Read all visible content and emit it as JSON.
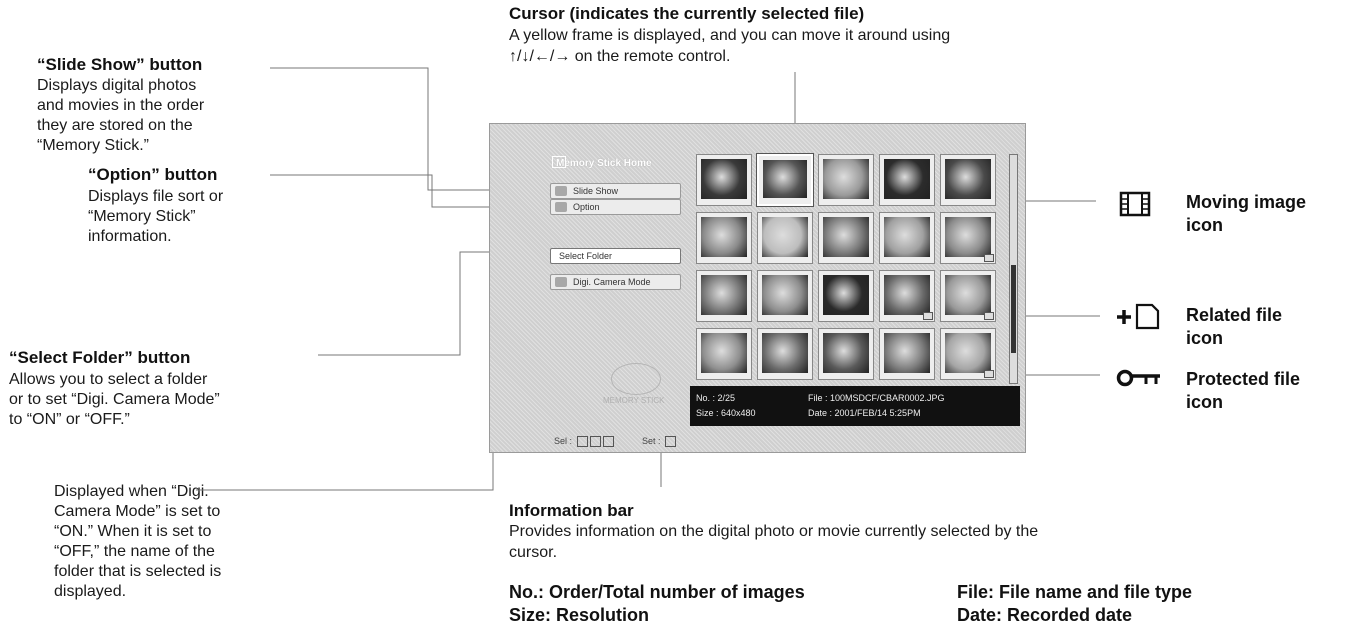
{
  "annotations": {
    "cursor": {
      "title": "Cursor (indicates the currently selected file)",
      "line1": "A yellow frame is displayed, and you can move it around using",
      "line2": "↑/↓/←/→ on the remote control."
    },
    "slide_show": {
      "title": "“Slide Show” button",
      "lines": [
        "Displays digital photos",
        "and movies in the order",
        "they are stored on the",
        "“Memory Stick.”"
      ]
    },
    "option": {
      "title": "“Option” button",
      "lines": [
        "Displays file sort or",
        "“Memory Stick”",
        "information."
      ]
    },
    "select_folder": {
      "title": "“Select Folder” button",
      "lines": [
        "Allows you to select a folder",
        "or to set “Digi. Camera Mode”",
        "to “ON” or “OFF.”"
      ]
    },
    "digi_mode": {
      "lines": [
        "Displayed when “Digi.",
        "Camera Mode” is set to",
        "“ON.” When it is set to",
        "“OFF,” the name of the",
        "folder that is selected is",
        "displayed."
      ]
    },
    "info_bar": {
      "title": "Information bar",
      "line1": "Provides information on the digital photo or movie currently selected by the",
      "line2": "cursor.",
      "no": "No.: Order/Total number of images",
      "size": "Size: Resolution",
      "file": "File: File name and file type",
      "date": "Date: Recorded date"
    },
    "moving_image": {
      "lines": [
        "Moving image",
        "icon"
      ],
      "icon": "film-icon"
    },
    "related_file": {
      "lines": [
        "Related file",
        "icon"
      ],
      "icon": "plus-document-icon"
    },
    "protected_file": {
      "lines": [
        "Protected file",
        "icon"
      ],
      "icon": "key-icon"
    }
  },
  "screen": {
    "title": "Memory Stick Home",
    "buttons": {
      "slide_show": "Slide Show",
      "option": "Option",
      "select_folder": "Select Folder",
      "digi_camera_mode": "Digi. Camera Mode"
    },
    "info": {
      "no": "No. : 2/25",
      "size": "Size : 640x480",
      "file": "File : 100MSDCF/CBAR0002.JPG",
      "date": "Date : 2001/FEB/14 5:25PM"
    },
    "footer": {
      "sel": "Sel :",
      "set": "Set :"
    },
    "thumbnails": [
      {
        "shade": "#3a3a3a"
      },
      {
        "shade": "#555"
      },
      {
        "shade": "#9a9a9a"
      },
      {
        "shade": "#2c2c2c"
      },
      {
        "shade": "#4a4a4a"
      },
      {
        "shade": "#8a8a8a"
      },
      {
        "shade": "#bdbdbd"
      },
      {
        "shade": "#7a7a7a"
      },
      {
        "shade": "#a0a0a0"
      },
      {
        "shade": "#8c8c8c"
      },
      {
        "shade": "#777"
      },
      {
        "shade": "#8e8e8e"
      },
      {
        "shade": "#2a2a2a"
      },
      {
        "shade": "#6a6a6a"
      },
      {
        "shade": "#999"
      },
      {
        "shade": "#8f8f8f"
      },
      {
        "shade": "#6b6b6b"
      },
      {
        "shade": "#5a5a5a"
      },
      {
        "shade": "#7c7c7c"
      },
      {
        "shade": "#a5a5a5"
      }
    ]
  }
}
